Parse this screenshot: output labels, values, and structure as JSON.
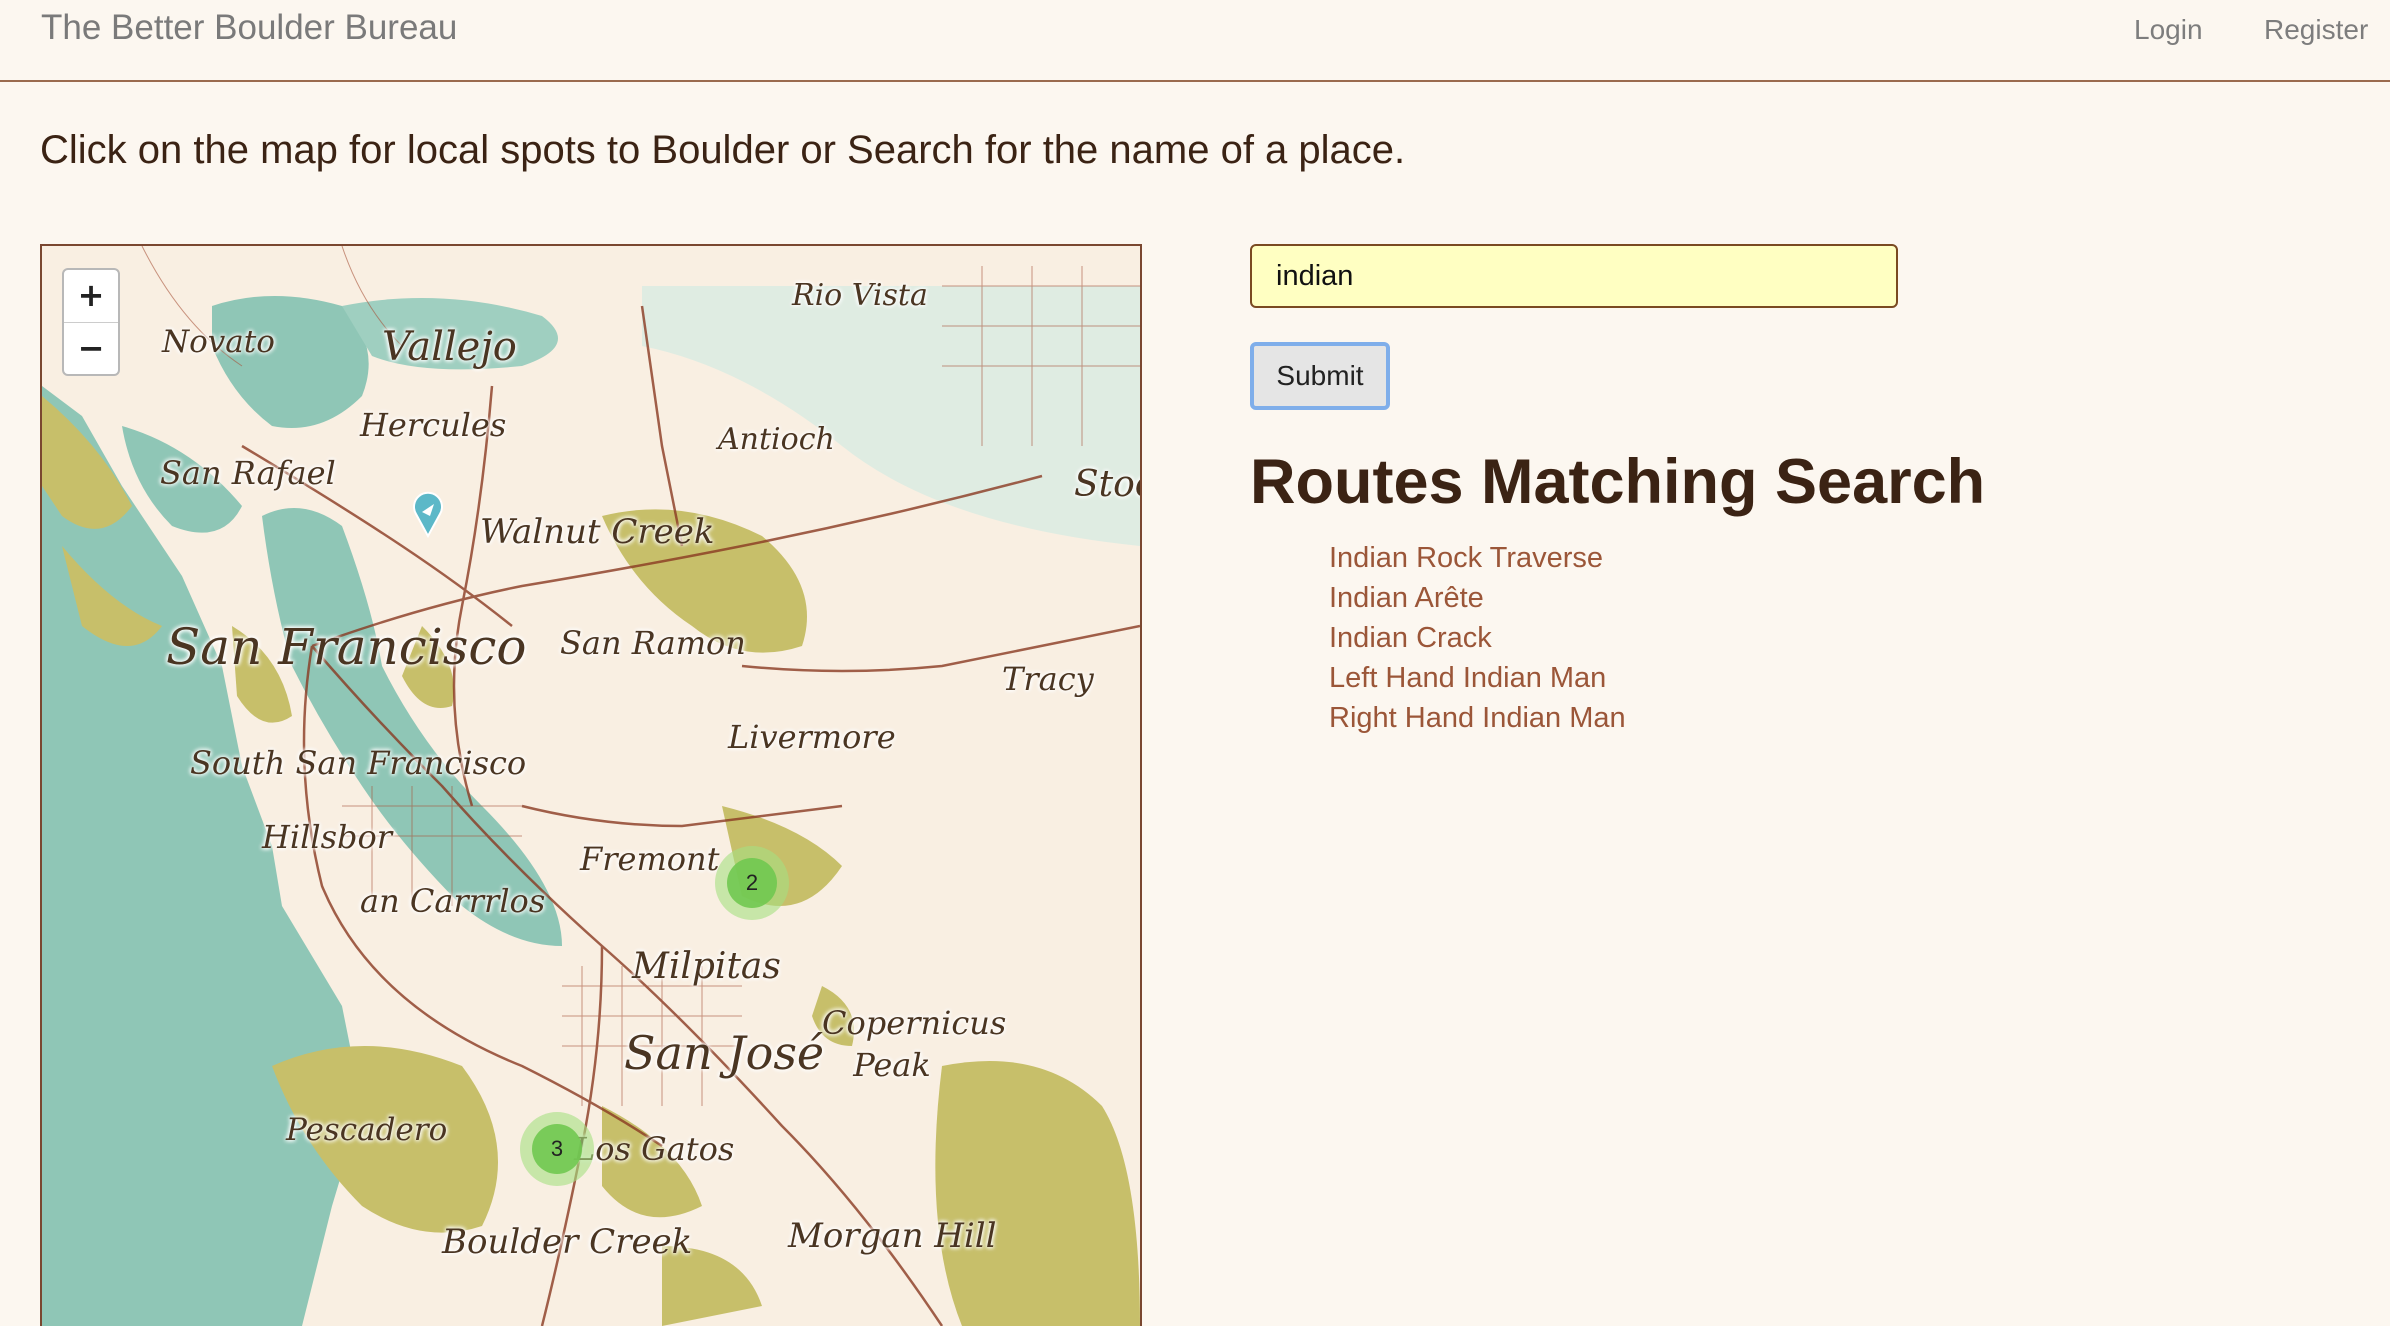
{
  "navbar": {
    "brand": "The Better Boulder Bureau",
    "login": "Login",
    "register": "Register"
  },
  "intro_text": "Click on the map for local spots to Boulder or Search for the name of a place.",
  "map": {
    "zoom_in": "+",
    "zoom_out": "−",
    "places": [
      "Novato",
      "Vallejo",
      "Rio Vista",
      "Hercules",
      "Antioch",
      "San Rafael",
      "Walnut Creek",
      "Stoc",
      "San Francisco",
      "San Ramon",
      "Tracy",
      "Livermore",
      "South San Francisco",
      "Hillsbor",
      "Fremont",
      "an Carrrlos",
      "Milpitas",
      "Copernicus Peak",
      "San José",
      "Pescadero",
      "Los Gatos",
      "Boulder Creek",
      "Morgan Hill"
    ],
    "clusters": [
      {
        "count": "2"
      },
      {
        "count": "3"
      }
    ],
    "colors": {
      "water": "#8fc6b6",
      "land": "#f9efe2",
      "parks": "#c7bf6a",
      "roads": "#8a3a22"
    }
  },
  "search": {
    "value": "indian",
    "submit_label": "Submit"
  },
  "results": {
    "heading": "Routes Matching Search",
    "items": [
      "Indian Rock Traverse",
      "Indian Arête",
      "Indian Crack",
      "Left Hand Indian Man",
      "Right Hand Indian Man"
    ]
  }
}
